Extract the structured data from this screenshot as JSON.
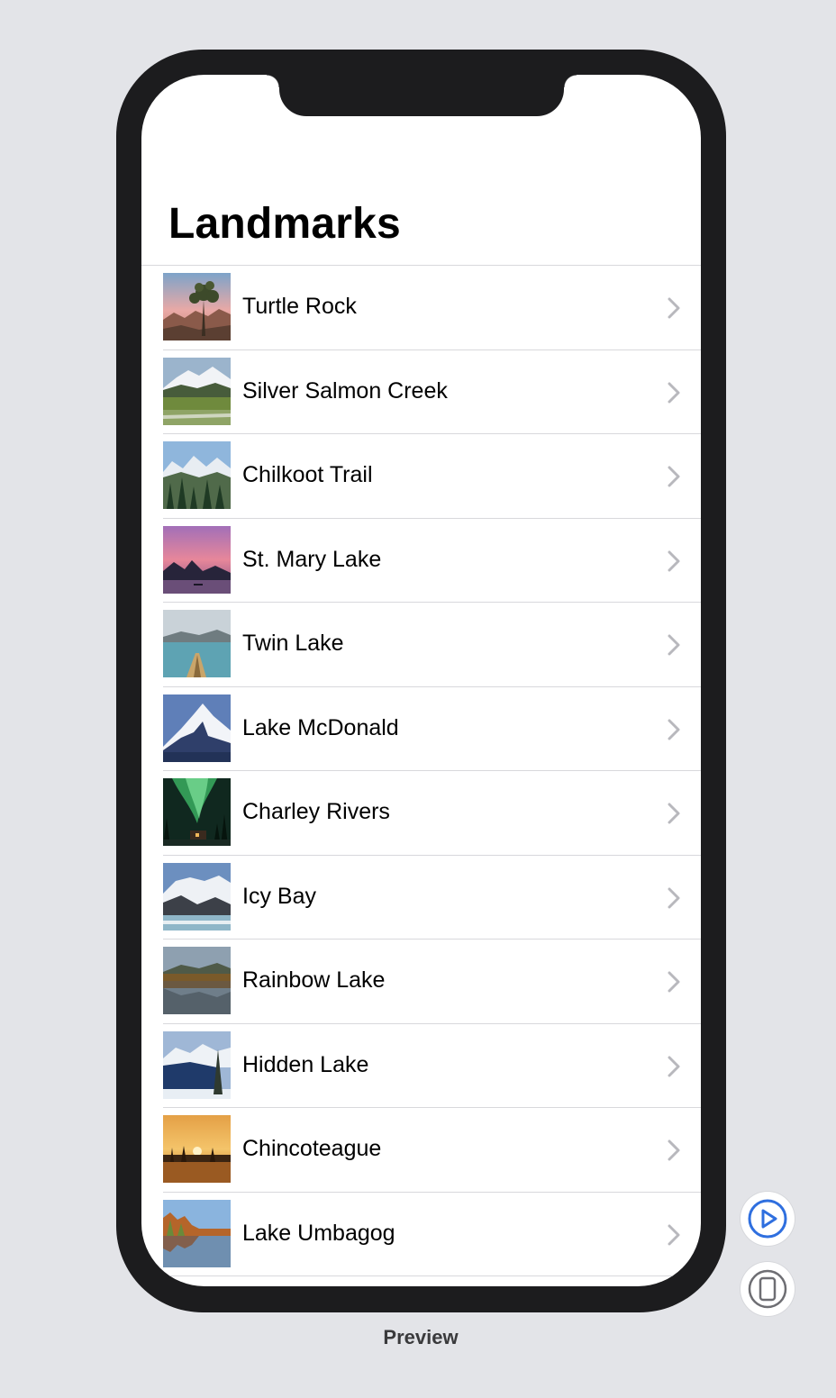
{
  "screen": {
    "title": "Landmarks"
  },
  "landmarks": [
    {
      "name": "Turtle Rock"
    },
    {
      "name": "Silver Salmon Creek"
    },
    {
      "name": "Chilkoot Trail"
    },
    {
      "name": "St. Mary Lake"
    },
    {
      "name": "Twin Lake"
    },
    {
      "name": "Lake McDonald"
    },
    {
      "name": "Charley Rivers"
    },
    {
      "name": "Icy Bay"
    },
    {
      "name": "Rainbow Lake"
    },
    {
      "name": "Hidden Lake"
    },
    {
      "name": "Chincoteague"
    },
    {
      "name": "Lake Umbagog"
    }
  ],
  "canvas_controls": {
    "live_preview_icon": "play-circle-icon",
    "device_settings_icon": "iphone-icon",
    "label": "Preview"
  },
  "colors": {
    "accent": "#2f6fdf",
    "chevron": "#b8b8bd",
    "device_frame": "#1c1c1e",
    "canvas_background": "#e3e4e8"
  }
}
